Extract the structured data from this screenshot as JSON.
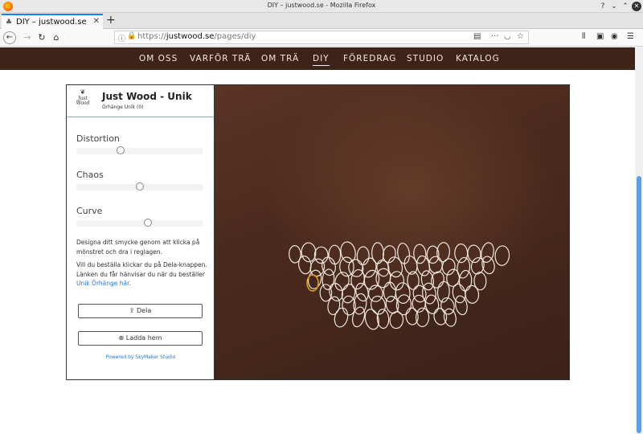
{
  "window": {
    "title": "DIY – justwood.se - Mozilla Firefox",
    "controls": {
      "help": "?",
      "minimize": "⌄",
      "maximize": "⌃",
      "close": "✕"
    }
  },
  "tabs": [
    {
      "label": "DIY – justwood.se",
      "close": "✕"
    }
  ],
  "new_tab": "+",
  "nav": {
    "url_prefix": "https://",
    "url_domain": "justwood.se",
    "url_path": "/pages/diy"
  },
  "site_nav": {
    "items": [
      "OM OSS",
      "VARFÖR TRÄ",
      "OM TRÄ",
      "DIY",
      "FÖREDRAG",
      "STUDIO",
      "KATALOG"
    ],
    "active": "DIY"
  },
  "panel": {
    "logo_text": "Just Wood",
    "title": "Just Wood - Unik",
    "subtitle": "Örhänge Unik (0)",
    "sliders": [
      {
        "label": "Distortion",
        "value": 0.34
      },
      {
        "label": "Chaos",
        "value": 0.5
      },
      {
        "label": "Curve",
        "value": 0.57
      }
    ],
    "help1": "Designa ditt smycke genom att klicka på mönstret och dra i reglagen.",
    "help2": "Vill du beställa klickar du på Dela-knappen. Länken du får hänvisar du när du beställer",
    "help_link": "Unik Örhänge här",
    "help_end": ".",
    "share_button": "Dela",
    "download_button": "Ladda hem",
    "powered": "Powered by SkyMaker Studio"
  },
  "colors": {
    "site_nav_bg": "#3e2418",
    "link": "#2a76c4",
    "ring_stroke": "#efe6dc",
    "ring_selected": "#d4a017"
  },
  "icons": {
    "share": "share-icon",
    "download": "download-icon"
  }
}
